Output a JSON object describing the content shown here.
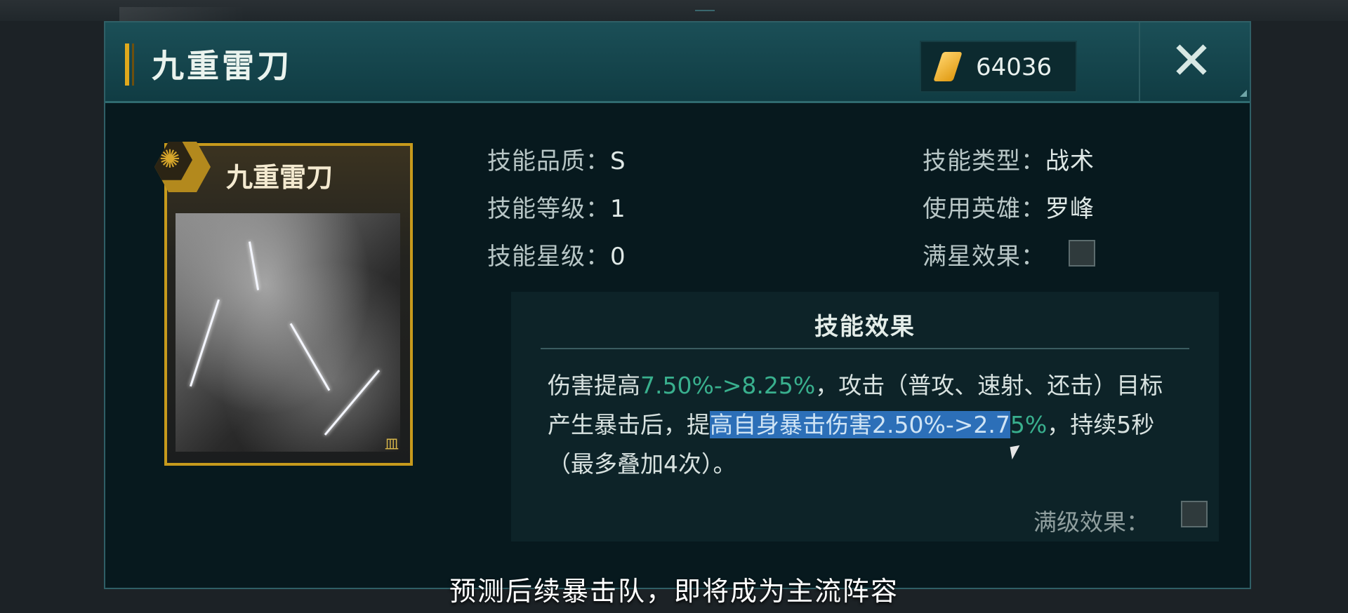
{
  "header": {
    "title": "九重雷刀",
    "currency_amount": "64036",
    "currency_icon": "gold-crystal-icon",
    "close_icon": "close-icon"
  },
  "card": {
    "name": "九重雷刀",
    "emblem_icon": "lotus-hex-icon",
    "footer_mark": "皿"
  },
  "attributes": {
    "quality_label": "技能品质：",
    "quality_value": "S",
    "level_label": "技能等级：",
    "level_value": "1",
    "star_label": "技能星级：",
    "star_value": "0",
    "type_label": "技能类型：",
    "type_value": "战术",
    "hero_label": "使用英雄：",
    "hero_value": "罗峰",
    "full_star_label": "满星效果："
  },
  "effect": {
    "title": "技能效果",
    "p1": "伤害提高",
    "v1": "7.50%->8.25%",
    "p2": "，攻击（普攻、速射、还击）目标产生暴击后，提",
    "p3": "高自身暴击伤害",
    "v2a": "2.50%->2.7",
    "v2b": "5%",
    "p4": "，持续5秒（最多叠加4次）。",
    "full_level_label": "满级效果："
  },
  "subtitle": "预测后续暴击队，即将成为主流阵容",
  "colors": {
    "accent_gold": "#c79a1c",
    "highlight_green": "#39b08e",
    "selection_blue": "#2c6fb8"
  }
}
